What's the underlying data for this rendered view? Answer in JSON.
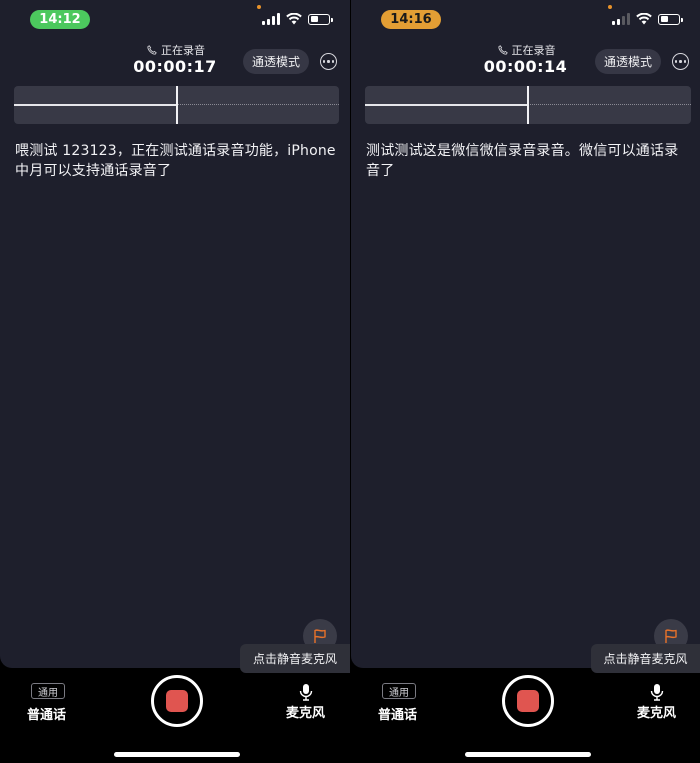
{
  "screens": [
    {
      "status_time": "14:12",
      "time_pill_color": "#4cc85e",
      "rec_status": "正在录音",
      "rec_time": "00:00:17",
      "mode_label": "通透模式",
      "transcript": "喂测试 123123，正在测试通话录音功能，iPhone 中月可以支持通话录音了",
      "tooltip": "点击静音麦克风",
      "tag_general": "通用",
      "normal_call": "普通话",
      "mic_label": "麦克风"
    },
    {
      "status_time": "14:16",
      "time_pill_color": "#e39e34",
      "rec_status": "正在录音",
      "rec_time": "00:00:14",
      "mode_label": "通透模式",
      "transcript": "测试测试这是微信微信录音录音。微信可以通话录音了",
      "tooltip": "点击静音麦克风",
      "tag_general": "通用",
      "normal_call": "普通话",
      "mic_label": "麦克风"
    }
  ],
  "colors": {
    "background": "#1e1f2c",
    "record_stop": "#e05550",
    "flag_orange": "#e8722a"
  },
  "icons": [
    "phone-icon",
    "more-icon",
    "flag-icon",
    "mic-icon",
    "record-stop-icon",
    "wifi-icon",
    "signal-icon",
    "battery-icon"
  ]
}
